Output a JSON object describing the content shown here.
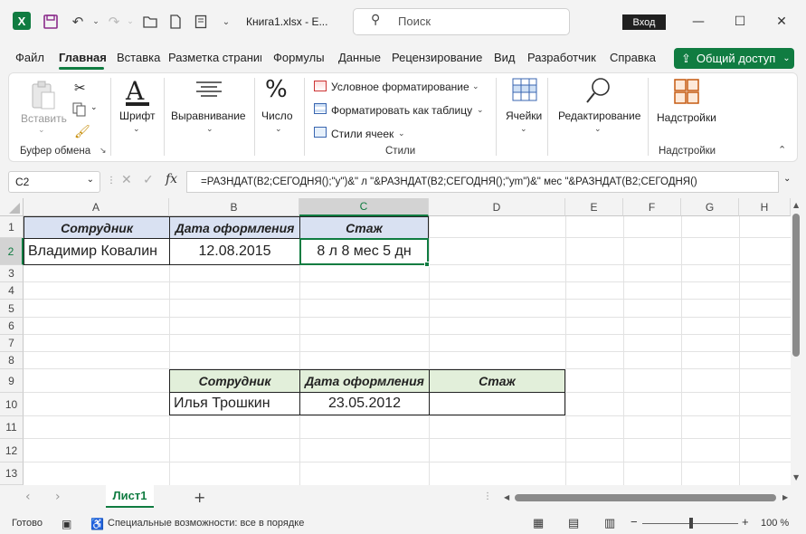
{
  "titlebar": {
    "doc_title": "Книга1.xlsx  -  E...",
    "search_placeholder": "Поиск",
    "login_label": "Вход"
  },
  "tabs": [
    "Файл",
    "Главная",
    "Вставка",
    "Разметка страниц",
    "Формулы",
    "Данные",
    "Рецензирование",
    "Вид",
    "Разработчик",
    "Справка"
  ],
  "active_tab": "Главная",
  "share_label": "Общий доступ",
  "ribbon": {
    "paste_label": "Вставить",
    "clipboard_group": "Буфер обмена",
    "font_label": "Шрифт",
    "align_label": "Выравнивание",
    "number_label": "Число",
    "cond_format": "Условное форматирование",
    "format_table": "Форматировать как таблицу",
    "cell_styles": "Стили ячеек",
    "styles_group": "Стили",
    "cells_label": "Ячейки",
    "editing_label": "Редактирование",
    "addins_label": "Надстройки",
    "addins_group": "Надстройки"
  },
  "formula_bar": {
    "name_box": "C2",
    "fx": "fx",
    "formula": "=РАЗНДАТ(B2;СЕГОДНЯ();\"y\")&\" л \"&РАЗНДАТ(B2;СЕГОДНЯ();\"ym\")&\" мес \"&РАЗНДАТ(B2;СЕГОДНЯ()"
  },
  "columns": [
    "A",
    "B",
    "C",
    "D",
    "E",
    "F",
    "G",
    "H"
  ],
  "rows": [
    "1",
    "2",
    "3",
    "4",
    "5",
    "6",
    "7",
    "8",
    "9",
    "10",
    "11",
    "12",
    "13"
  ],
  "table1": {
    "headers": [
      "Сотрудник",
      "Дата оформления",
      "Стаж"
    ],
    "row": [
      "Владимир Ковалин",
      "12.08.2015",
      "8 л 8 мес 5 дн"
    ]
  },
  "table2": {
    "headers": [
      "Сотрудник",
      "Дата оформления",
      "Стаж"
    ],
    "row": [
      "Илья Трошкин",
      "23.05.2012",
      ""
    ]
  },
  "sheet_tab": "Лист1",
  "status": {
    "ready": "Готово",
    "accessibility": "Специальные возможности: все в порядке",
    "zoom": "100 %"
  }
}
